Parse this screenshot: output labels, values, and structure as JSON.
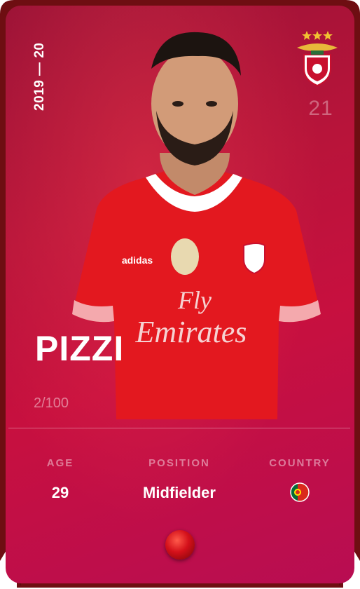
{
  "card": {
    "season": "2019 — 20",
    "jersey_number": "21",
    "player_name": "PIZZI",
    "serial": "2/100",
    "stats": {
      "age_label": "AGE",
      "age_value": "29",
      "position_label": "POSITION",
      "position_value": "Midfielder",
      "country_label": "COUNTRY",
      "country_flag": "portugal-flag-icon"
    },
    "club_crest": "benfica-crest-icon",
    "rarity_gem": "red-gem-icon",
    "colors": {
      "card_primary": "#c7103f",
      "card_dark": "#9a1236",
      "frame": "#6e0e12",
      "jersey_red": "#e3181f"
    }
  }
}
